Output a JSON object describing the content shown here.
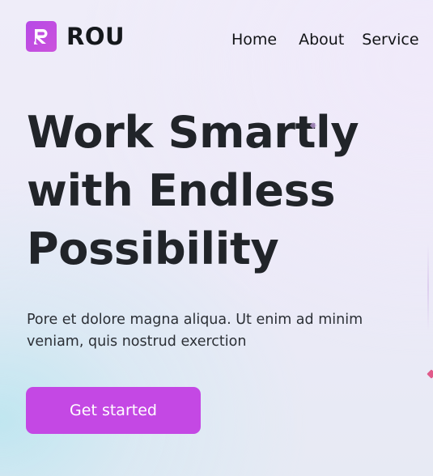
{
  "brand": {
    "logo_icon": "r-logo-icon",
    "name": "ROU",
    "accent_color": "#c448e4"
  },
  "nav": {
    "items": [
      {
        "label": "Home"
      },
      {
        "label": "About"
      },
      {
        "label": "Service"
      }
    ]
  },
  "hero": {
    "title_lines": [
      "Work Smartly",
      "with Endless",
      "Possibility"
    ],
    "subtitle": "Pore et dolore magna aliqua. Ut enim ad minim veniam, quis nostrud exerction",
    "cta_label": "Get started"
  }
}
